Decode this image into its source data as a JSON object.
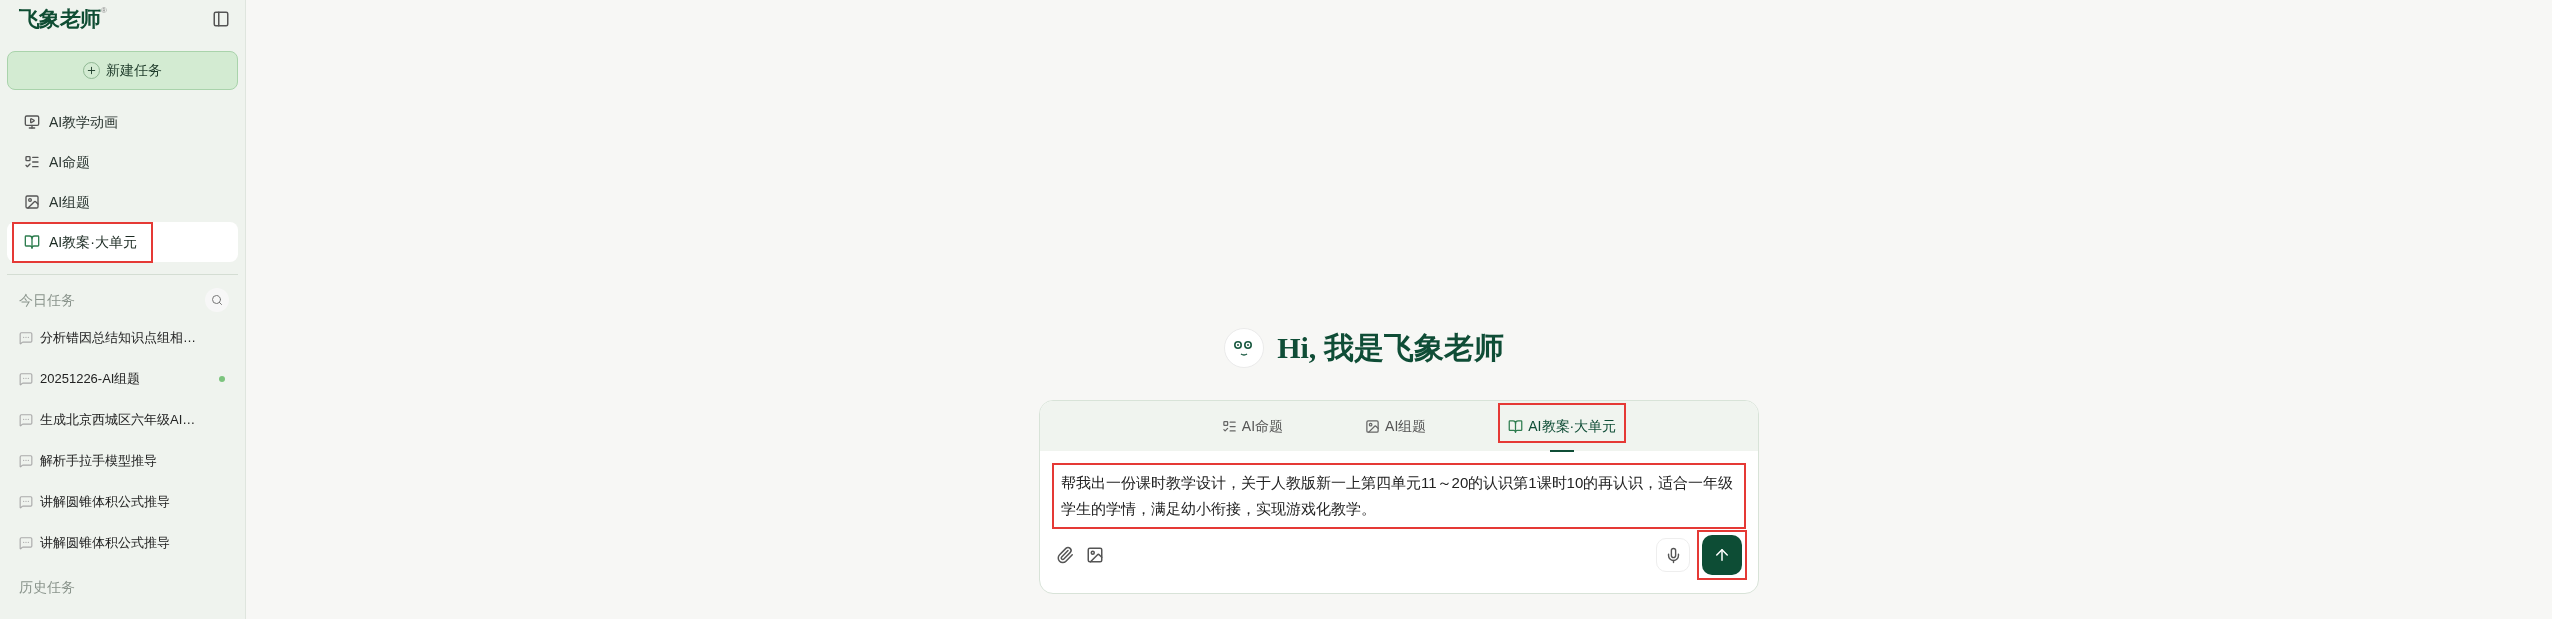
{
  "sidebar": {
    "logo": "飞象老师",
    "logo_mark": "®",
    "new_task": "新建任务",
    "nav": [
      {
        "label": "AI教学动画",
        "kind": "video",
        "selected": false,
        "highlighted": false
      },
      {
        "label": "AI命题",
        "kind": "list",
        "selected": false,
        "highlighted": false
      },
      {
        "label": "AI组题",
        "kind": "photo",
        "selected": false,
        "highlighted": false
      },
      {
        "label": "AI教案·大单元",
        "kind": "book",
        "selected": true,
        "highlighted": true
      }
    ],
    "today_title": "今日任务",
    "today": [
      {
        "label": "分析错因总结知识点组相…",
        "unread": false
      },
      {
        "label": "20251226-AI组题",
        "unread": true
      },
      {
        "label": "生成北京西城区六年级AI…",
        "unread": false
      },
      {
        "label": "解析手拉手模型推导",
        "unread": false
      },
      {
        "label": "讲解圆锥体积公式推导",
        "unread": false
      },
      {
        "label": "讲解圆锥体积公式推导",
        "unread": false
      }
    ],
    "history_title": "历史任务"
  },
  "greeting": "Hi, 我是飞象老师",
  "composer": {
    "tabs": [
      {
        "label": "AI命题",
        "kind": "list",
        "selected": false,
        "highlighted": false
      },
      {
        "label": "AI组题",
        "kind": "photo",
        "selected": false,
        "highlighted": false
      },
      {
        "label": "AI教案·大单元",
        "kind": "book",
        "selected": true,
        "highlighted": true
      }
    ],
    "value": "帮我出一份课时教学设计，关于人教版新一上第四单元11～20的认识第1课时10的再认识，适合一年级学生的学情，满足幼小衔接，实现游戏化教学。",
    "value_highlighted": true,
    "send_highlighted": true
  }
}
